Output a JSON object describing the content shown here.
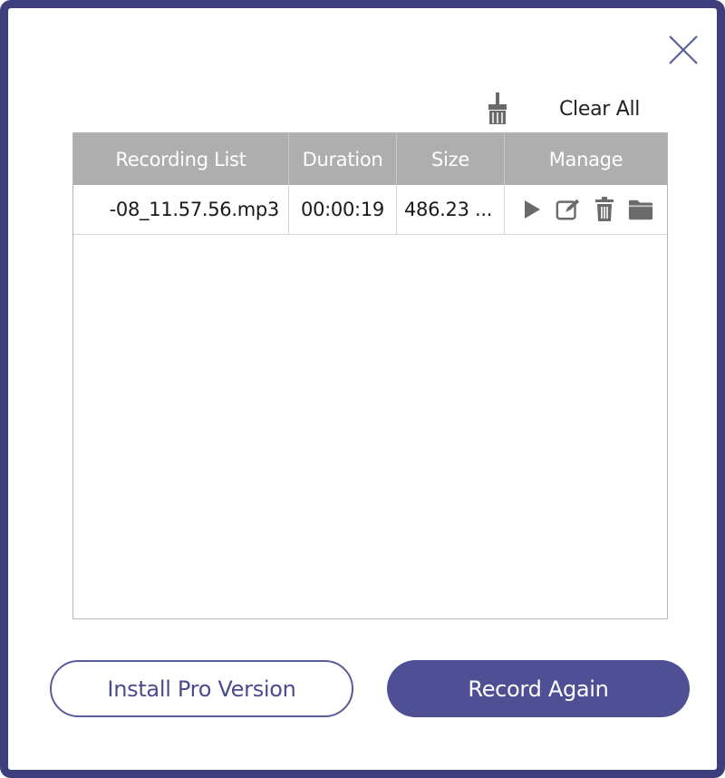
{
  "dialog": {
    "close_icon": "close-icon",
    "clear_all": {
      "icon": "broom-icon",
      "label": "Clear All"
    }
  },
  "table": {
    "headers": [
      "Recording List",
      "Duration",
      "Size",
      "Manage"
    ],
    "rows": [
      {
        "name": "-08_11.57.56.mp3",
        "duration": "00:00:19",
        "size": "486.23 ...",
        "actions": [
          "play-icon",
          "edit-icon",
          "trash-icon",
          "folder-icon"
        ]
      }
    ]
  },
  "buttons": {
    "install_pro": "Install Pro Version",
    "record_again": "Record Again"
  },
  "colors": {
    "frame": "#3d3f7d",
    "accent": "#4f4f96",
    "header_bg": "#aeaeae"
  }
}
